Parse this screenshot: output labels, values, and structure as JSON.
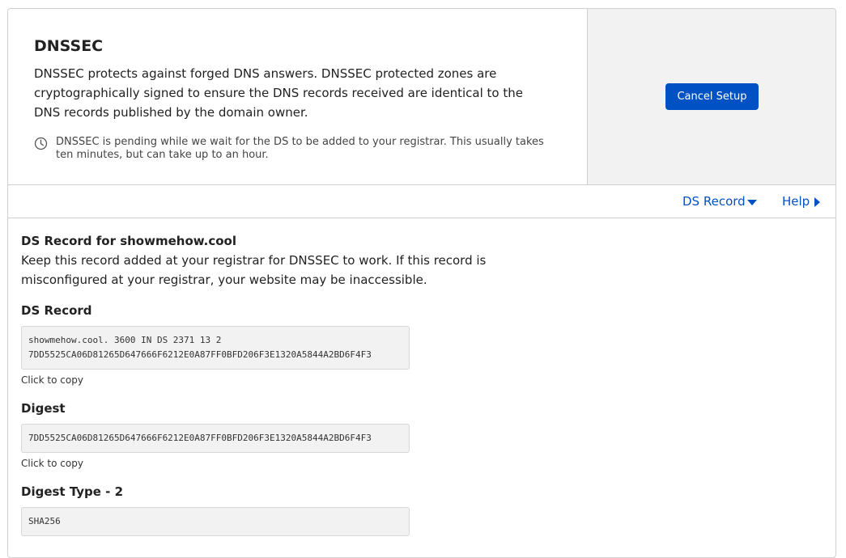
{
  "header": {
    "title": "DNSSEC",
    "description": "DNSSEC protects against forged DNS answers. DNSSEC protected zones are cryptographically signed to ensure the DNS records received are identical to the DNS records published by the domain owner.",
    "pending_notice": "DNSSEC is pending while we wait for the DS to be added to your registrar. This usually takes ten minutes, but can take up to an hour.",
    "pending_icon": "clock-icon",
    "cancel_button": "Cancel Setup"
  },
  "links": {
    "ds_record": "DS Record",
    "ds_record_icon": "caret-down-icon",
    "help": "Help",
    "help_icon": "caret-right-icon"
  },
  "ds": {
    "heading": "DS Record for showmehow.cool",
    "description": "Keep this record added at your registrar for DNSSEC to work. If this record is misconfigured at your registrar, your website may be inaccessible.",
    "record_label": "DS Record",
    "record_line1": "showmehow.cool. 3600 IN DS 2371 13 2",
    "record_line2": "7DD5525CA06D81265D647666F6212E0A87FF0BFD206F3E1320A5844A2BD6F4F3",
    "copy_hint": "Click to copy",
    "digest_label": "Digest",
    "digest_value": "7DD5525CA06D81265D647666F6212E0A87FF0BFD206F3E1320A5844A2BD6F4F3",
    "digest_type_label": "Digest Type - 2",
    "digest_type_value": "SHA256"
  },
  "colors": {
    "accent": "#0051c3",
    "panel_bg": "#f2f2f2",
    "border": "#d0d0d0"
  }
}
